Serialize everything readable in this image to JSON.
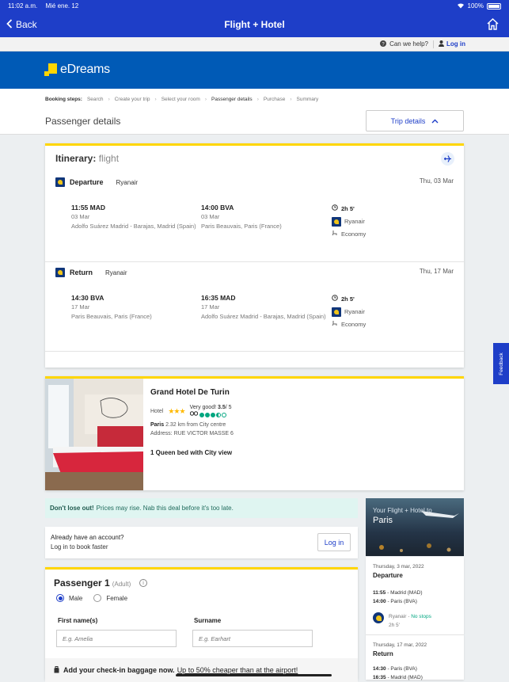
{
  "status_bar": {
    "time": "11:02 a.m.",
    "date": "Mié ene. 12",
    "battery": "100%"
  },
  "navbar": {
    "back_label": "Back",
    "title": "Flight + Hotel"
  },
  "helpbar": {
    "help_label": "Can we help?",
    "login_label": "Log in"
  },
  "brand": {
    "name": "eDreams"
  },
  "booking_steps": {
    "label": "Booking steps:",
    "steps": [
      "Search",
      "Create your trip",
      "Select your room",
      "Passenger details",
      "Purchase",
      "Summary"
    ],
    "active_step": "Passenger details"
  },
  "page_title": "Passenger details",
  "trip_details_button": "Trip details",
  "itinerary": {
    "title": "Itinerary:",
    "title_type": "flight",
    "legs": [
      {
        "direction": "Departure",
        "carrier": "Ryanair",
        "date": "Thu, 03 Mar",
        "from": {
          "time": "11:55 MAD",
          "date": "03 Mar",
          "airport": "Adolfo Suárez Madrid - Barajas, Madrid (Spain)"
        },
        "to": {
          "time": "14:00 BVA",
          "date": "03 Mar",
          "airport": "Paris Beauvais, Paris (France)"
        },
        "duration": "2h 5'",
        "airline": "Ryanair",
        "cabin": "Economy"
      },
      {
        "direction": "Return",
        "carrier": "Ryanair",
        "date": "Thu, 17 Mar",
        "from": {
          "time": "14:30 BVA",
          "date": "17 Mar",
          "airport": "Paris Beauvais, Paris (France)"
        },
        "to": {
          "time": "16:35 MAD",
          "date": "17 Mar",
          "airport": "Adolfo Suárez Madrid - Barajas, Madrid (Spain)"
        },
        "duration": "2h 5'",
        "airline": "Ryanair",
        "cabin": "Economy"
      }
    ]
  },
  "hotel": {
    "name": "Grand Hotel De Turin",
    "type": "Hotel",
    "stars": "★★★",
    "rating_text": "Very good!",
    "rating_score": "3.5",
    "rating_max": "/ 5",
    "city": "Paris",
    "distance": "2.32 km from City centre",
    "address": "Address: RUE VICTOR MASSE 6",
    "room": "1 Queen bed with City view"
  },
  "deal_banner": {
    "bold": "Don't lose out!",
    "text": "Prices may rise. Nab this deal before it's too late."
  },
  "account": {
    "line1": "Already have an account?",
    "line2": "Log in to book faster",
    "login_button": "Log in"
  },
  "passenger": {
    "title": "Passenger 1",
    "type": "(Adult)",
    "gender_options": [
      "Male",
      "Female"
    ],
    "selected_gender": "Male",
    "first_name_label": "First name(s)",
    "first_name_placeholder": "E.g. Amelia",
    "surname_label": "Surname",
    "surname_placeholder": "E.g. Earhart"
  },
  "baggage_banner": {
    "text": "Add your check-in baggage now.",
    "link": "Up to 50% cheaper than at the airport!"
  },
  "sidebar": {
    "hero_subtitle": "Your Flight + Hotel to",
    "hero_city": "Paris",
    "departure": {
      "date": "Thursday, 3 mar, 2022",
      "label": "Departure",
      "line1_time": "11:55",
      "line1_place": "- Madrid (MAD)",
      "line2_time": "14:00",
      "line2_place": "- Paris (BVA)",
      "airline": "Ryanair",
      "stops": "No stops",
      "duration": "2h 5'"
    },
    "return": {
      "date": "Thursday, 17 mar, 2022",
      "label": "Return",
      "line1_time": "14:30",
      "line1_place": "- Paris (BVA)",
      "line2_time": "16:35",
      "line2_place": "- Madrid (MAD)"
    }
  },
  "feedback_tab": "Feedback",
  "colors": {
    "primary": "#1e3ec8",
    "brand_bar": "#005ab6",
    "accent": "#ffd600",
    "deal_bg": "#dff5f1",
    "success": "#00a680"
  }
}
